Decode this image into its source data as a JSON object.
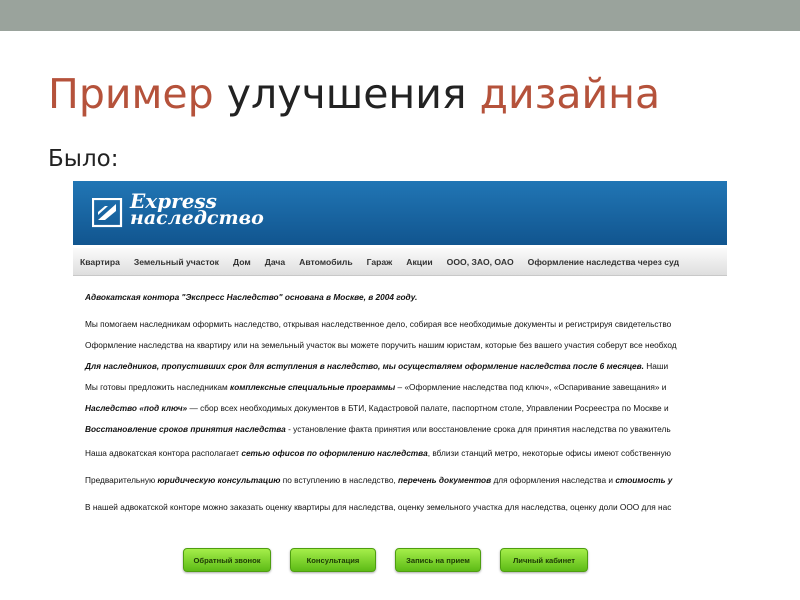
{
  "slide": {
    "title_part1": "Пример",
    "title_part2": "улучшения",
    "title_part3": "дизайна",
    "subtitle": "Было:"
  },
  "site": {
    "logo_line1": "Express",
    "logo_line2": "наследство",
    "nav": [
      "Квартира",
      "Земельный участок",
      "Дом",
      "Дача",
      "Автомобиль",
      "Гараж",
      "Акции",
      "ООО, ЗАО, ОАО",
      "Оформление наследства через суд"
    ],
    "lines": [
      [
        "Адвокатская контора \"Экспресс Наследство\" основана в Москве, в 2004 году."
      ],
      [
        "Мы помогаем наследникам оформить наследство, открывая наследственное дело, собирая все необходимые документы и регистрируя свидетельство"
      ],
      [
        "Оформление наследства на квартиру или на земельный участок вы можете поручить нашим юристам, которые без вашего участия соберут все необход"
      ],
      [
        "Для наследников, пропустивших срок для вступления в наследство, мы осуществляем оформление наследства после 6 месяцев.",
        " Наши"
      ],
      [
        "Мы готовы предложить наследникам ",
        "комплексные специальные программы",
        " – «Оформление наследства под ключ», «Оспаривание завещания» и"
      ],
      [
        "Наследство «под ключ»",
        " —   сбор всех необходимых документов в БТИ, Кадастровой палате, паспортном столе, Управлении Росреестра по Москве и"
      ],
      [
        "Восстановление сроков принятия наследства",
        " - установление факта принятия или восстановление срока для принятия наследства по уважитель"
      ],
      [
        "Наша адвокатская контора располагает ",
        "сетью офисов по оформлению наследства",
        ", вблизи станций метро, некоторые офисы имеют собственную"
      ],
      [
        "Предварительную ",
        "юридическую консультацию",
        " по вступлению в наследство, ",
        "перечень документов",
        " для оформления наследства и ",
        "стоимость у"
      ],
      [
        "В нашей адвокатской конторе можно заказать оценку квартиры для наследства, оценку земельного участка для наследства, оценку доли ООО для нас"
      ]
    ],
    "buttons": [
      "Обратный звонок",
      "Консультация",
      "Запись на прием",
      "Личный кабинет"
    ]
  },
  "colors": {
    "accent": "#b5523b",
    "topbar": "#9aa39c",
    "header_blue": "#1a69a8",
    "button_green": "#7fd52c"
  }
}
